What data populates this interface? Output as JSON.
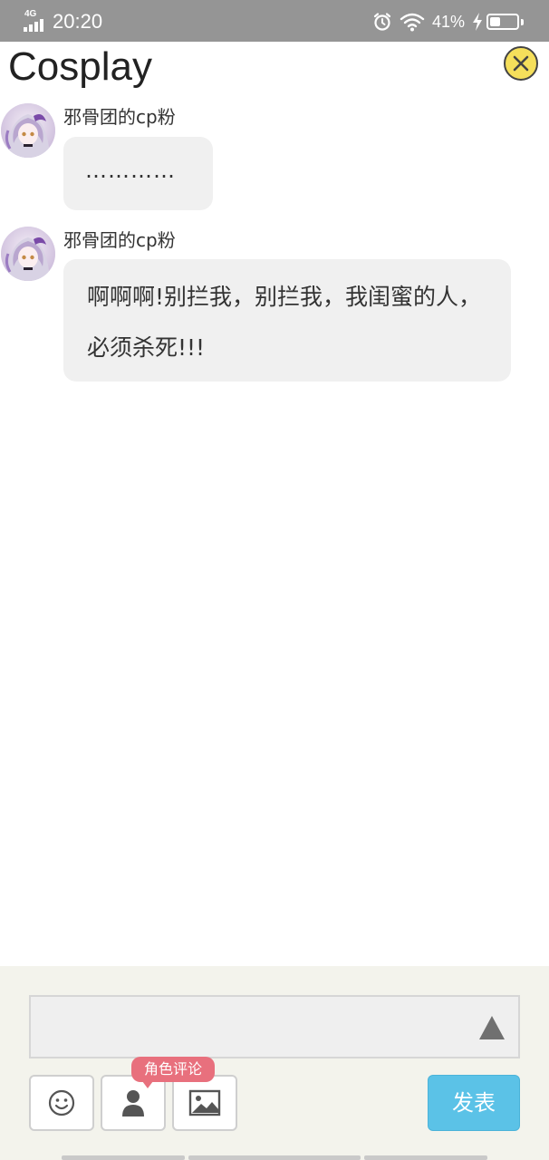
{
  "status_bar": {
    "network": "4G",
    "time": "20:20",
    "battery_percent": "41%",
    "battery_level": 0.41,
    "icons": [
      "signal-icon",
      "alarm-icon",
      "wifi-icon",
      "charging-icon",
      "battery-icon"
    ]
  },
  "header": {
    "title": "Cosplay",
    "close_icon": "close-icon",
    "accent_color": "#f5df5b"
  },
  "messages": [
    {
      "sender": "邪骨团的cp粉",
      "text": "…………",
      "avatar": "avatar-image"
    },
    {
      "sender": "邪骨团的cp粉",
      "text": "啊啊啊!别拦我，别拦我，我闺蜜的人，必须杀死!!!",
      "avatar": "avatar-image"
    }
  ],
  "composer": {
    "input_value": "",
    "input_placeholder": "",
    "expand_icon": "triangle-up-icon",
    "tools": [
      {
        "name": "emoji-button",
        "icon": "smiley-icon"
      },
      {
        "name": "role-button",
        "icon": "user-icon"
      },
      {
        "name": "image-button",
        "icon": "image-icon"
      }
    ],
    "role_badge": "角色评论",
    "role_badge_color": "#e8707d",
    "post_label": "发表",
    "post_color": "#5bc2e7"
  }
}
